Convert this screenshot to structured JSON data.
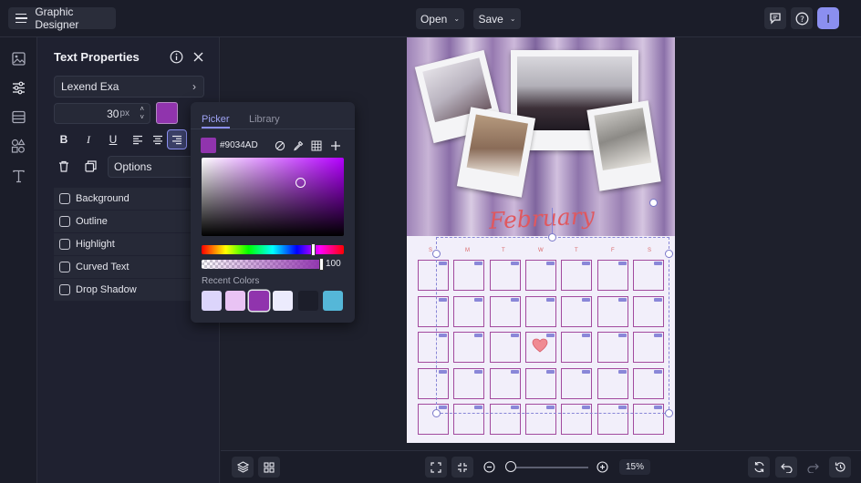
{
  "app": {
    "title": "Graphic Designer"
  },
  "topbar": {
    "open_label": "Open",
    "save_label": "Save",
    "user_initial": "I"
  },
  "panel": {
    "title": "Text Properties",
    "font_family": "Lexend Exa",
    "font_size": "30",
    "font_size_unit": "px",
    "options_label": "Options",
    "toggles": [
      "Background",
      "Outline",
      "Highlight",
      "Curved Text",
      "Drop Shadow"
    ]
  },
  "picker": {
    "tabs": [
      "Picker",
      "Library"
    ],
    "hex": "#9034AD",
    "opacity": "100",
    "recent_label": "Recent Colors"
  },
  "colors": {
    "accent": "#8b8ff0",
    "text_color": "#9034AD",
    "recent": [
      "#dcd5fb",
      "#e9c3f4",
      "#9034AD",
      "#ecebfd",
      "#1c1e2a",
      "#55b7d8"
    ]
  },
  "canvas": {
    "month_title": "February",
    "weekdays": [
      "S",
      "M",
      "T",
      "W",
      "T",
      "F",
      "S"
    ]
  },
  "bottombar": {
    "zoom": "15%"
  }
}
